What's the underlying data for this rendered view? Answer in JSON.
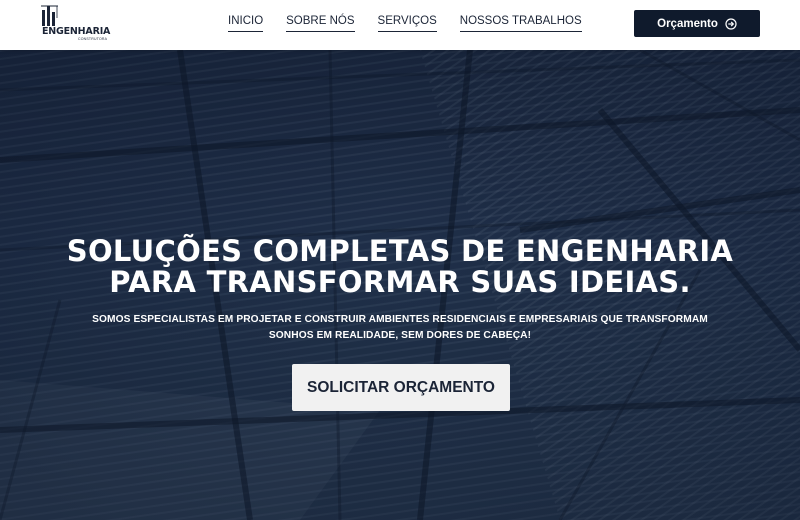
{
  "header": {
    "logo_name": "ENGENHARIA",
    "logo_sub": "CONSTRUTORA",
    "nav": [
      "INICIO",
      "SOBRE NÓS",
      "SERVIÇOS",
      "NOSSOS TRABALHOS"
    ],
    "cta_label": "Orçamento",
    "cta_icon": "arrow-right-circle-icon"
  },
  "hero": {
    "title_line1": "SOLUÇÕES COMPLETAS DE ENGENHARIA",
    "title_line2": "PARA TRANSFORMAR SUAS IDEIAS.",
    "subtitle": "SOMOS ESPECIALISTAS EM PROJETAR E CONSTRUIR AMBIENTES RESIDENCIAIS E EMPRESARIAIS QUE TRANSFORMAM SONHOS EM REALIDADE, SEM DORES DE CABEÇA!",
    "button_label": "SOLICITAR ORÇAMENTO"
  },
  "colors": {
    "navy": "#0f1a2c",
    "text_dark": "#1b2436",
    "hero_overlay": "#1f2f48",
    "button_light": "#f1f1f1"
  }
}
